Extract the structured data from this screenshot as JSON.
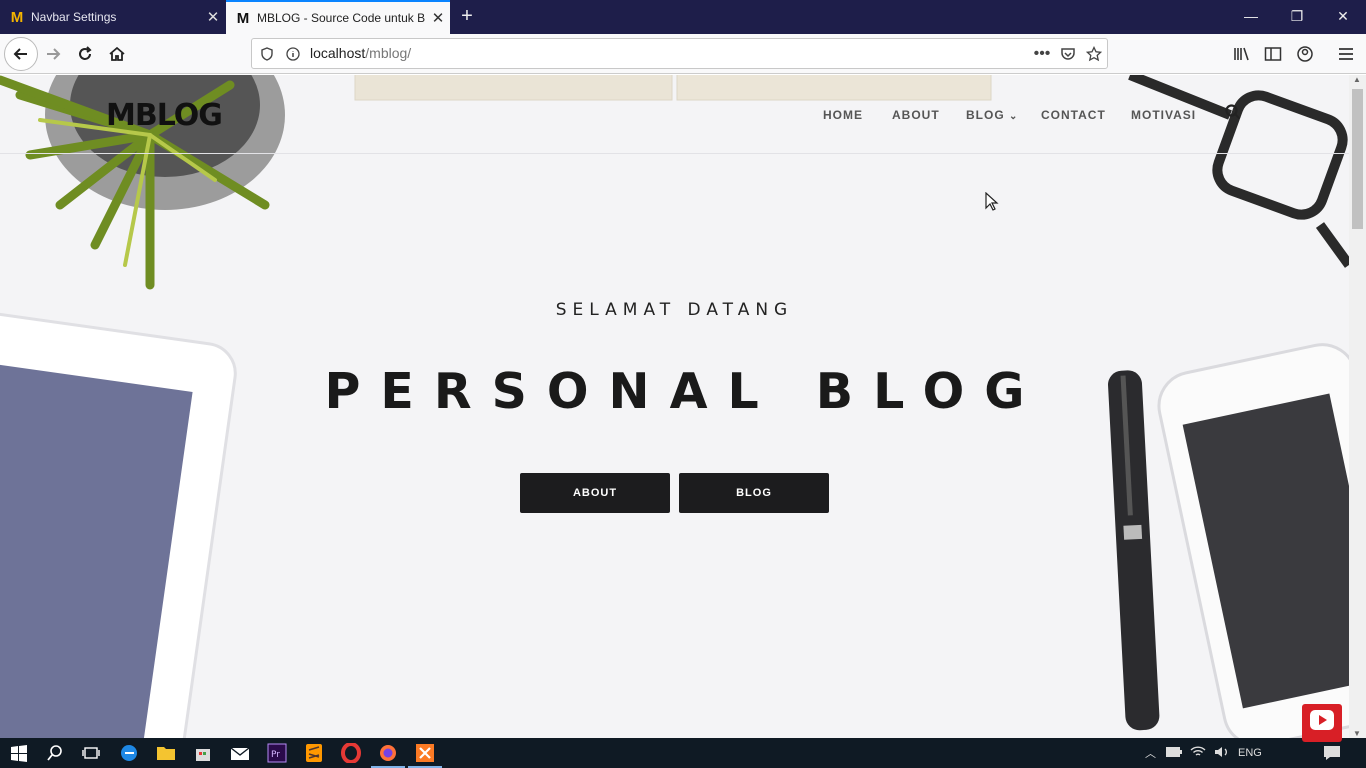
{
  "browser": {
    "tabs": [
      {
        "title": "Navbar Settings",
        "favicon": "M"
      },
      {
        "title": "MBLOG - Source Code untuk B",
        "favicon": "M"
      }
    ],
    "new_tab": "+",
    "url": {
      "host": "localhost",
      "path": "/mblog/"
    }
  },
  "site": {
    "brand": "MBLOG",
    "menu": [
      "HOME",
      "ABOUT",
      "BLOG",
      "CONTACT",
      "MOTIVASI"
    ],
    "blog_caret": "⌄",
    "hero": {
      "subtitle": "SELAMAT DATANG",
      "title": "PERSONAL BLOG",
      "buttons": [
        "ABOUT",
        "BLOG"
      ]
    }
  },
  "taskbar": {
    "language": "ENG"
  },
  "colors": {
    "tabbar": "#1e1e4a",
    "button_dark": "#1c1c1e",
    "accent": "#0a84ff"
  }
}
